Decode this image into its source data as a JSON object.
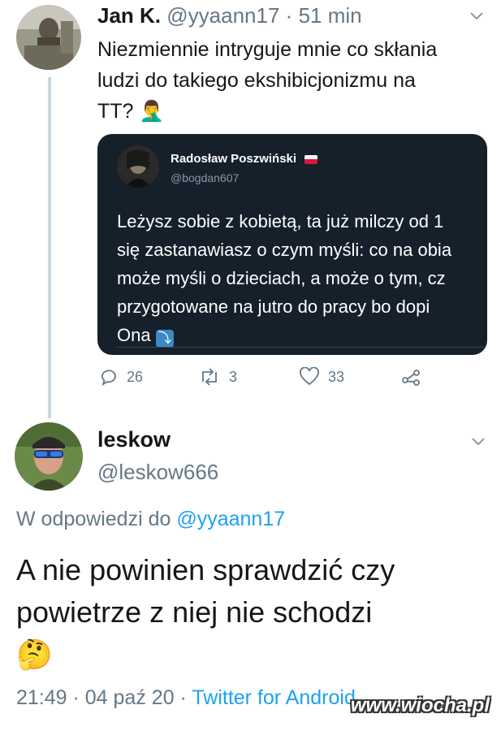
{
  "tweet1": {
    "name": "Jan K.",
    "handle": "@yyaann17",
    "separator": "·",
    "time": "51 min",
    "text": "Niezmiennie intryguje mnie co skłania ludzi do takiego ekshibicjonizmu na TT?",
    "emoji": "🤦‍♂️"
  },
  "quoted": {
    "name": "Radosław Poszwiński",
    "handle": "@bogdan607",
    "lines": [
      "Leżysz sobie z kobietą, ta już milczy od 1",
      "się zastanawiasz o czym myśli: co na obia",
      "może myśli o dzieciach, a może o tym, cz",
      "przygotowane na jutro do pracy bo dopi",
      "Ona"
    ],
    "arrow": "⤵"
  },
  "actions": {
    "replies": "26",
    "retweets": "3",
    "likes": "33"
  },
  "tweet2": {
    "name": "leskow",
    "handle": "@leskow666",
    "reply_prefix": "W odpowiedzi do",
    "reply_handle": "@yyaann17",
    "text": "A nie powinien sprawdzić czy powietrze z niej nie schodzi",
    "emoji": "🤔",
    "timestamp": "21:49 · 04 paź 20 ·",
    "client": "Twitter for Android"
  },
  "watermark": "www.wiocha.pl",
  "colors": {
    "link": "#1da1f2",
    "secondary": "#657786",
    "card_bg": "#15202b"
  }
}
